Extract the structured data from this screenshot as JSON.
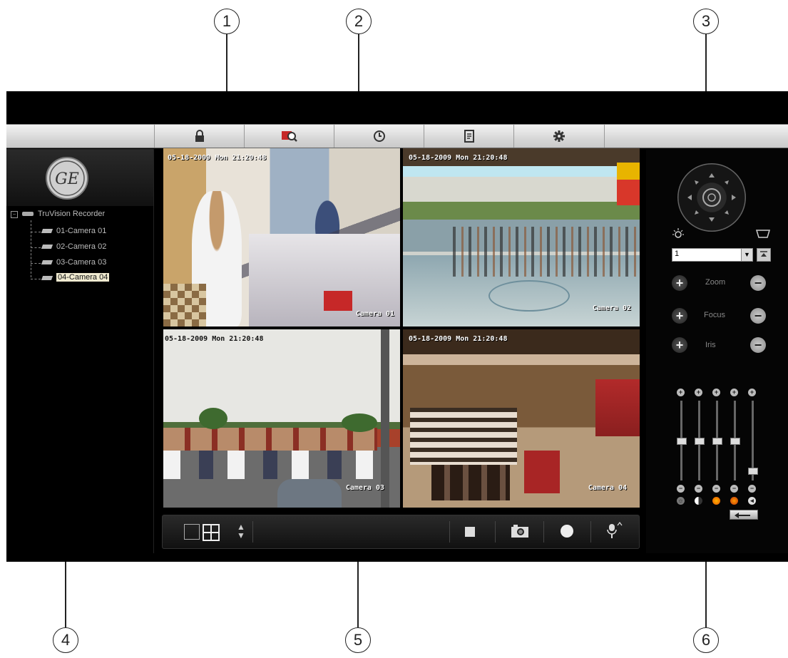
{
  "callouts": [
    "1",
    "2",
    "3",
    "4",
    "5",
    "6"
  ],
  "toolbar": {
    "buttons": [
      "lock-icon",
      "search-icon",
      "clock-icon",
      "log-icon",
      "gear-icon"
    ]
  },
  "sidebar": {
    "logo": "GE",
    "tree_root": "TruVision Recorder",
    "cameras": [
      "01-Camera 01",
      "02-Camera 02",
      "03-Camera 03",
      "04-Camera 04"
    ],
    "selected_camera": "04-Camera 04"
  },
  "video": {
    "tiles": [
      {
        "timestamp": "05-18-2009 Mon 21:20:48",
        "label": "Camera 01"
      },
      {
        "timestamp": "05-18-2009 Mon 21:20:48",
        "label": "Camera 02"
      },
      {
        "timestamp": "05-18-2009 Mon 21:20:48",
        "label": "Camera 03"
      },
      {
        "timestamp": "05-18-2009 Mon 21:20:48",
        "label": "Camera 04"
      }
    ]
  },
  "ptz": {
    "preset_value": "1",
    "zoom_label": "Zoom",
    "focus_label": "Focus",
    "iris_label": "Iris",
    "sliders": [
      0.5,
      0.5,
      0.5,
      0.5,
      0.1
    ]
  },
  "colors": {
    "accent_red": "#c62828",
    "toolbar_bg": "#d7d7d7"
  }
}
